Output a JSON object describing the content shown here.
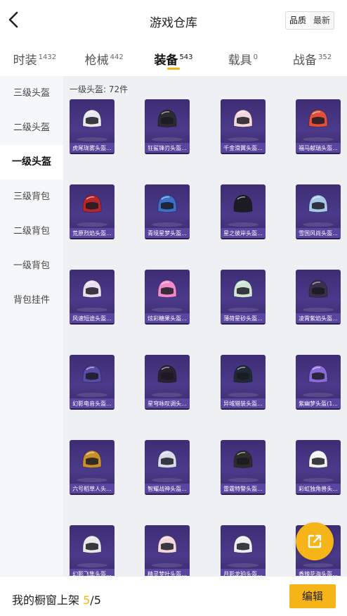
{
  "header": {
    "title": "游戏仓库",
    "back_icon": "chevron-left-icon",
    "sort_options": [
      "品质",
      "最新"
    ],
    "sort_selected": "品质"
  },
  "tabs": [
    {
      "label": "时装",
      "count": "1432",
      "active": false
    },
    {
      "label": "枪械",
      "count": "442",
      "active": false
    },
    {
      "label": "装备",
      "count": "543",
      "active": true
    },
    {
      "label": "载具",
      "count": "0",
      "active": false
    },
    {
      "label": "战备",
      "count": "352",
      "active": false
    }
  ],
  "sidebar": {
    "items": [
      {
        "label": "三级头盔",
        "active": false
      },
      {
        "label": "二级头盔",
        "active": false
      },
      {
        "label": "一级头盔",
        "active": true
      },
      {
        "label": "三级背包",
        "active": false
      },
      {
        "label": "二级背包",
        "active": false
      },
      {
        "label": "一级背包",
        "active": false
      },
      {
        "label": "背包挂件",
        "active": false
      }
    ]
  },
  "content": {
    "section_label": "一级头盔: 72件",
    "items": [
      {
        "name": "虎尾珑雾头盔...",
        "color": "#e8e8ee"
      },
      {
        "name": "狂鲨锋刃头盔...",
        "color": "#2a2a30"
      },
      {
        "name": "千金滑翼头盔...",
        "color": "#f4d6dc"
      },
      {
        "name": "福马献瑞头盔...",
        "color": "#e0503a"
      },
      {
        "name": "荒原烈焰头盔...",
        "color": "#b8262a"
      },
      {
        "name": "青境星梦头盔...",
        "color": "#3b6fc8"
      },
      {
        "name": "星之彼岸头盔...",
        "color": "#1c1c24"
      },
      {
        "name": "雪国风尚头盔...",
        "color": "#a8c8e8"
      },
      {
        "name": "风速短途头盔...",
        "color": "#eadff2"
      },
      {
        "name": "炫彩糖果头盔...",
        "color": "#f08ac8"
      },
      {
        "name": "薄荷星砂头盔...",
        "color": "#cfe6d6"
      },
      {
        "name": "凌霄紫焰头盔...",
        "color": "#3a3048"
      },
      {
        "name": "幻影电音头盔...",
        "color": "#5a4aa8"
      },
      {
        "name": "星穹咏叹调头...",
        "color": "#2a2030"
      },
      {
        "name": "异域猎装头盔...",
        "color": "#1e2a34"
      },
      {
        "name": "紫幽梦头盔(1...",
        "color": "#8a6ad8"
      },
      {
        "name": "六号稻草人头...",
        "color": "#c8902a"
      },
      {
        "name": "智耀战神头盔...",
        "color": "#d8dcea"
      },
      {
        "name": "雷霆特警头盔...",
        "color": "#2c2c2c"
      },
      {
        "name": "彩虹独角兽头...",
        "color": "#f2f2f2"
      },
      {
        "name": "幻影飞隼头盔...",
        "color": "#e8e8ec"
      },
      {
        "name": "精灵梦叶头盔...",
        "color": "#f2d6dc"
      },
      {
        "name": "月影龙珀头盔...",
        "color": "#eceef4"
      },
      {
        "name": "香辣花海头盔...",
        "color": "#d84a3a"
      }
    ]
  },
  "fab": {
    "icon": "external-link-icon"
  },
  "footer": {
    "label": "我的橱窗上架",
    "count": "5",
    "total": "/5",
    "edit_label": "编辑"
  }
}
